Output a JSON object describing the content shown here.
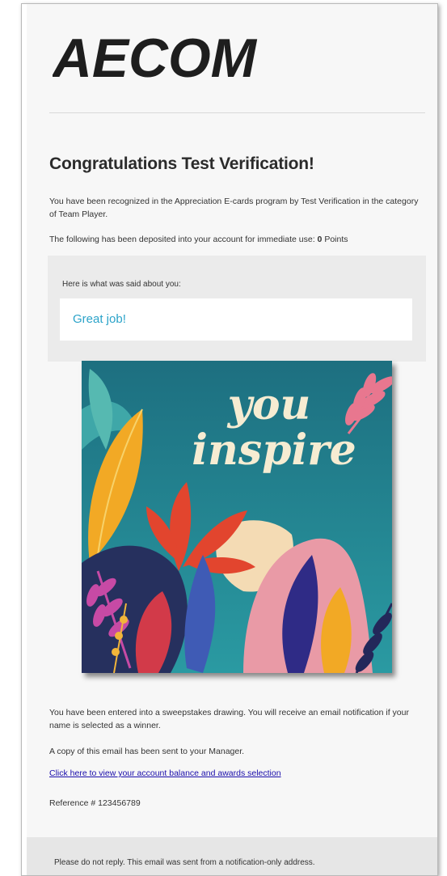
{
  "brand": {
    "logo_text": "AECOM",
    "logo_color": "#1e1e1e"
  },
  "email": {
    "headline": "Congratulations Test Verification!",
    "recognition_text": "You have been recognized in the Appreciation E-cards program by Test Verification in the category of Team Player.",
    "deposit_text": "The following has been deposited into your account for immediate use:",
    "deposit_amount": "0",
    "deposit_unit": "Points",
    "said_label": "Here is what was said about you:",
    "said_message": "Great job!",
    "ecard": {
      "line1": "you",
      "line2": "inspire"
    },
    "sweepstakes_text": "You have been entered into a sweepstakes drawing. You will receive an email notification if your name is selected as a winner.",
    "manager_copy_text": "A copy of this email has been sent to your Manager.",
    "account_link_text": "Click here to view your account balance and awards selection",
    "reference_text": "Reference # 123456789",
    "footer_text": "Please do not reply. This email was sent from a notification-only address."
  },
  "colors": {
    "accent_message": "#2ba3c9",
    "link": "#1a0dab",
    "card_background": "#17707f"
  }
}
